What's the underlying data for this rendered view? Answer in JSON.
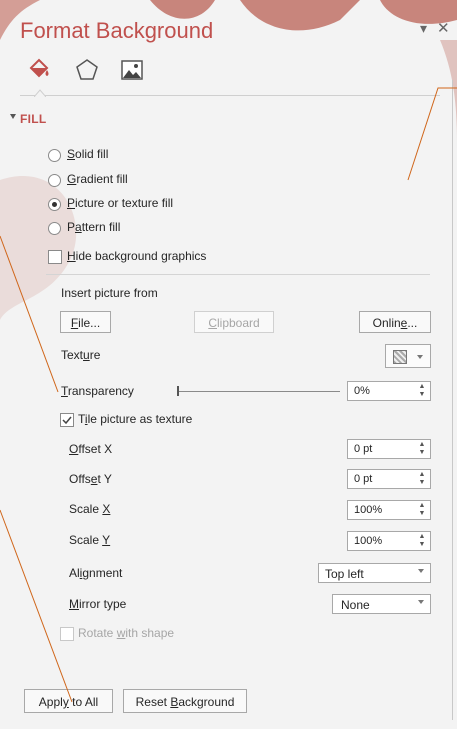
{
  "pane": {
    "title": "Format Background",
    "menu_glyph": "▾",
    "close_glyph": "✕",
    "icons": [
      "fill-bucket-icon",
      "pentagon-icon",
      "picture-icon"
    ]
  },
  "fill": {
    "section_label": "FILL",
    "radios": [
      {
        "label": "Solid fill",
        "accel": "S",
        "rest": "olid fill",
        "selected": false
      },
      {
        "label": "Gradient fill",
        "accel": "G",
        "rest": "radient fill",
        "selected": false
      },
      {
        "label": "Picture or texture fill",
        "accel": "P",
        "rest": "icture or texture fill",
        "selected": true
      },
      {
        "label": "Pattern fill",
        "accel": "a",
        "pre": "P",
        "rest": "ttern fill",
        "selected": false
      }
    ],
    "hide_bg": {
      "accel": "H",
      "rest": "ide background graphics",
      "checked": false
    }
  },
  "insert": {
    "label": "Insert picture from",
    "file_btn": {
      "accel": "F",
      "rest": "ile..."
    },
    "clipboard_btn": {
      "accel": "C",
      "rest": "lipboard"
    },
    "online_btn": {
      "pre": "Onlin",
      "accel": "e",
      "rest": "..."
    }
  },
  "texture": {
    "pre": "Text",
    "accel": "u",
    "rest": "re"
  },
  "transparency": {
    "accel": "T",
    "rest": "ransparency",
    "value": "0%",
    "level": 0
  },
  "tile": {
    "pre": "T",
    "accel": "i",
    "rest": "le picture as texture",
    "checked": true
  },
  "rows": [
    {
      "key": "offset_x",
      "pre": "",
      "accel": "O",
      "rest": "ffset X",
      "value": "0 pt"
    },
    {
      "key": "offset_y",
      "pre": "Offs",
      "accel": "e",
      "rest": "t Y",
      "value": "0 pt"
    },
    {
      "key": "scale_x",
      "pre": "Scale ",
      "accel": "X",
      "rest": "",
      "value": "100%"
    },
    {
      "key": "scale_y",
      "pre": "Scale ",
      "accel": "Y",
      "rest": "",
      "value": "100%"
    }
  ],
  "alignment": {
    "pre": "Al",
    "accel": "i",
    "rest": "gnment",
    "value": "Top left"
  },
  "mirror": {
    "pre": "",
    "accel": "M",
    "rest": "irror type",
    "value": "None"
  },
  "rotate": {
    "pre": "Rotate ",
    "accel": "w",
    "rest": "ith shape",
    "checked": false,
    "disabled": true
  },
  "footer": {
    "apply_all": {
      "pre": "Appl",
      "accel": "y",
      "rest": " to All"
    },
    "reset": {
      "pre": "Reset ",
      "accel": "B",
      "rest": "ackground"
    }
  },
  "colors": {
    "accent": "#c0504d",
    "deco": "#b5645a",
    "orange_line": "#d0661a"
  }
}
